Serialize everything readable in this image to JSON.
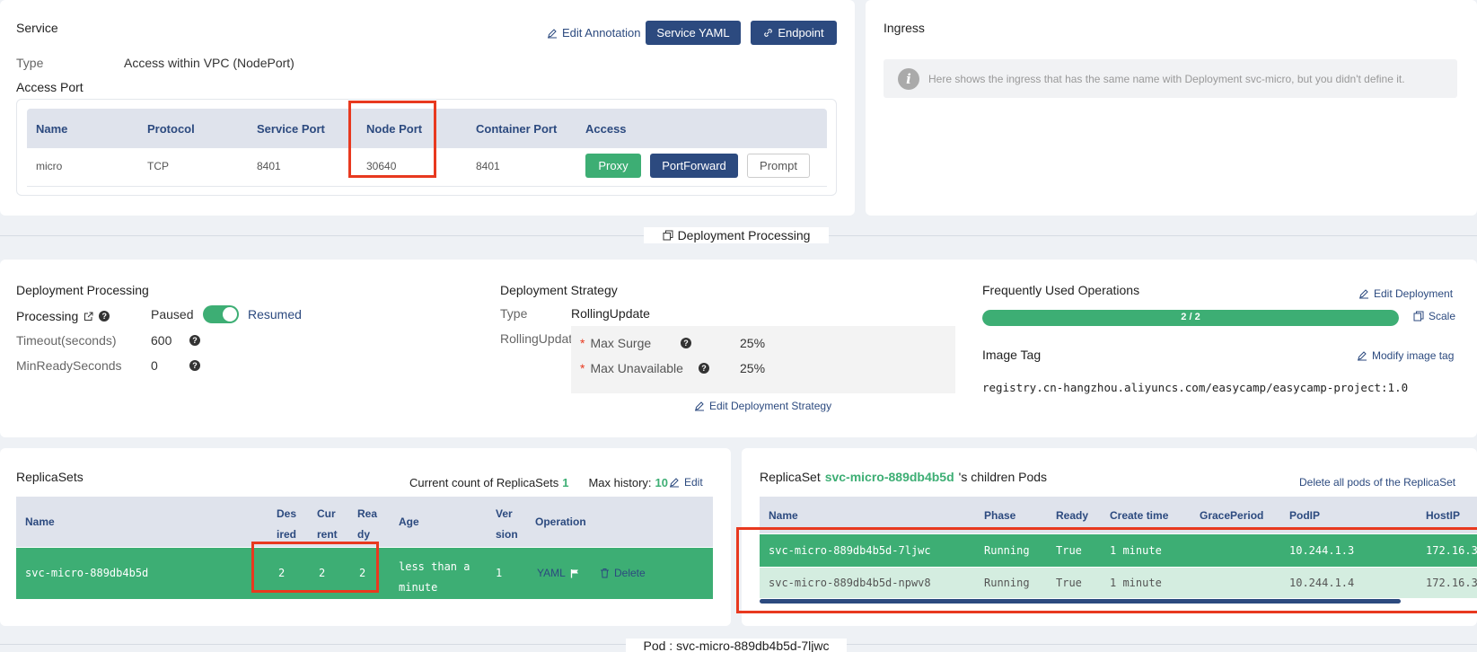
{
  "service": {
    "title": "Service",
    "edit_annotation": "Edit Annotation",
    "service_yaml": "Service YAML",
    "endpoint": "Endpoint",
    "type_label": "Type",
    "type_value": "Access within VPC (NodePort)",
    "access_port_label": "Access Port",
    "table": {
      "headers": [
        "Name",
        "Protocol",
        "Service Port",
        "Node Port",
        "Container Port",
        "Access"
      ],
      "row": [
        "micro",
        "TCP",
        "8401",
        "30640",
        "8401"
      ],
      "proxy": "Proxy",
      "portforward": "PortForward",
      "prompt": "Prompt"
    }
  },
  "ingress": {
    "title": "Ingress",
    "info": "Here shows the ingress that has the same name with Deployment svc-micro, but you didn't define it."
  },
  "section_deploy": "Deployment Processing",
  "deploy": {
    "title": "Deployment Processing",
    "processing_label": "Processing",
    "paused": "Paused",
    "resumed": "Resumed",
    "timeout_label": "Timeout(seconds)",
    "timeout_value": "600",
    "minready_label": "MinReadySeconds",
    "minready_value": "0"
  },
  "strategy": {
    "title": "Deployment Strategy",
    "type_label": "Type",
    "type_value": "RollingUpdate",
    "rolling_label": "RollingUpdat",
    "max_surge_label": "Max Surge",
    "max_surge_value": "25%",
    "max_unavail_label": "Max Unavailable",
    "max_unavail_value": "25%",
    "edit": "Edit Deployment Strategy"
  },
  "ops": {
    "title": "Frequently Used Operations",
    "edit_deployment": "Edit Deployment",
    "progress_text": "2 / 2",
    "progress_fraction": 1.0,
    "scale": "Scale",
    "image_tag_title": "Image Tag",
    "modify_image": "Modify image tag",
    "image": "registry.cn-hangzhou.aliyuncs.com/easycamp/easycamp-project:1.0"
  },
  "replicasets": {
    "title": "ReplicaSets",
    "count_label": "Current count of ReplicaSets",
    "count": "1",
    "history_label": "Max history:",
    "history": "10",
    "edit": "Edit",
    "headers": {
      "name": "Name",
      "desired1": "Des",
      "desired2": "ired",
      "current1": "Cur",
      "current2": "rent",
      "ready1": "Rea",
      "ready2": "dy",
      "age": "Age",
      "version1": "Ver",
      "version2": "sion",
      "operation": "Operation"
    },
    "row": {
      "name": "svc-micro-889db4b5d",
      "desired": "2",
      "current": "2",
      "ready": "2",
      "age1": "less than a",
      "age2": "minute",
      "version": "1",
      "yaml": "YAML",
      "delete": "Delete"
    }
  },
  "pods": {
    "title_prefix": "ReplicaSet",
    "title_rs": "svc-micro-889db4b5d",
    "title_suffix": "'s children Pods",
    "delete_all": "Delete all pods of the ReplicaSet",
    "headers": [
      "Name",
      "Phase",
      "Ready",
      "Create time",
      "GracePeriod",
      "PodIP",
      "HostIP"
    ],
    "rows": [
      [
        "svc-micro-889db4b5d-7ljwc",
        "Running",
        "True",
        "1 minute",
        "",
        "10.244.1.3",
        "172.16.3"
      ],
      [
        "svc-micro-889db4b5d-npwv8",
        "Running",
        "True",
        "1 minute",
        "",
        "10.244.1.4",
        "172.16.3"
      ]
    ]
  },
  "section_pod": "Pod : svc-micro-889db4b5d-7ljwc",
  "colors": {
    "accent": "#2c4a7f",
    "green": "#3dae74",
    "highlight": "#e8391f"
  }
}
